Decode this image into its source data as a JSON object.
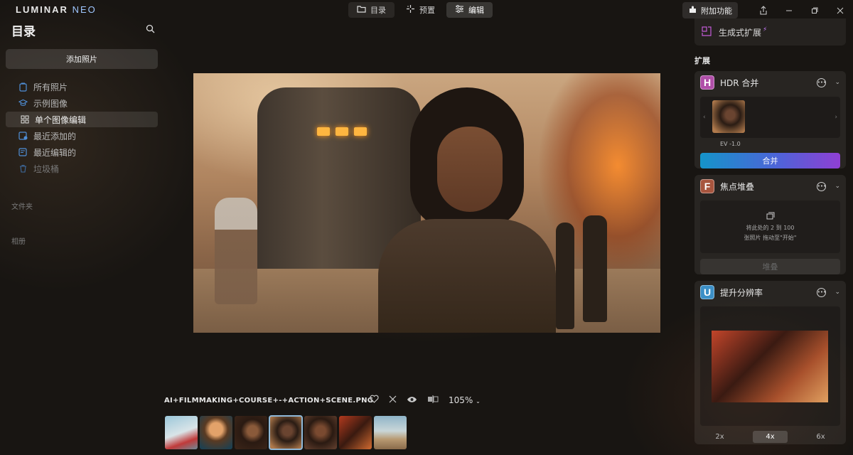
{
  "app": {
    "logo_main": "LUMINAR",
    "logo_accent": "NEO"
  },
  "topnav": {
    "tabs": [
      {
        "label": "目录",
        "icon": "folder-icon"
      },
      {
        "label": "预置",
        "icon": "sparkle-icon"
      },
      {
        "label": "编辑",
        "icon": "sliders-icon"
      }
    ],
    "active_tab": "编辑",
    "addons_label": "附加功能"
  },
  "sidebar": {
    "title": "目录",
    "add_photos_label": "添加照片",
    "items": [
      {
        "label": "所有照片",
        "icon": "photos-icon"
      },
      {
        "label": "示例图像",
        "icon": "graduation-cap-icon"
      },
      {
        "label": "单个图像编辑",
        "icon": "grid-icon"
      },
      {
        "label": "最近添加的",
        "icon": "recent-added-icon"
      },
      {
        "label": "最近编辑的",
        "icon": "recent-edited-icon"
      },
      {
        "label": "垃圾桶",
        "icon": "trash-icon"
      }
    ],
    "active_item": "单个图像编辑",
    "sections": [
      "文件夹",
      "相册"
    ]
  },
  "viewer": {
    "filename": "AI+FILMMAKING+COURSE+-+ACTION+SCENE.PNG",
    "zoom": "105%"
  },
  "filmstrip": {
    "count": 7,
    "selected_index": 3
  },
  "right_panel": {
    "generative_expand_label": "生成式扩展",
    "extensions_label": "扩展",
    "hdr": {
      "badge": "H",
      "title": "HDR 合并",
      "ev_label": "EV -1.0",
      "button": "合并",
      "badge_color": "#b04fa8"
    },
    "focus": {
      "badge": "F",
      "title": "焦点堆叠",
      "drop_line1": "将此处的 2 到 100",
      "drop_line2": "张照片 拖动至\"开始\"",
      "button": "堆叠",
      "badge_color": "#a7553e"
    },
    "upscale": {
      "badge": "U",
      "title": "提升分辨率",
      "scales": [
        "2x",
        "4x",
        "6x"
      ],
      "active_scale": "4x",
      "badge_color": "#3c8fc6"
    }
  }
}
